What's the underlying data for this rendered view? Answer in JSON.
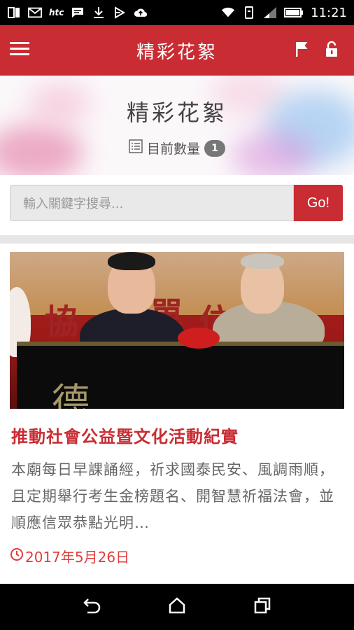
{
  "status_bar": {
    "carrier": "htc",
    "time": "11:21",
    "left_icons": [
      "sim-icon",
      "gmail-icon",
      "htc-icon",
      "message-icon",
      "download-icon",
      "nfc-icon",
      "cloud-upload-icon"
    ],
    "right_icons": [
      "wifi-icon",
      "vibrate-icon",
      "signal-icon",
      "battery-icon"
    ]
  },
  "app_bar": {
    "title": "精彩花絮",
    "menu_icon": "hamburger-menu-icon",
    "actions": [
      "flag-icon",
      "lock-icon"
    ]
  },
  "hero": {
    "title": "精彩花絮",
    "count_label": "目前數量",
    "count_value": "1"
  },
  "search": {
    "placeholder": "輸入關鍵字搜尋...",
    "button_label": "Go!"
  },
  "articles": [
    {
      "title": "推動社會公益暨文化活動紀實",
      "description": "本廟每日早課誦經，祈求國泰民安、風調雨順，且定期舉行考生金榜題名、開智慧祈福法會，並順應信眾恭點光明…",
      "date": "2017年5月26日"
    }
  ],
  "nav_bar": {
    "buttons": [
      "back-icon",
      "home-icon",
      "recent-apps-icon"
    ]
  },
  "colors": {
    "primary": "#c92c32",
    "date": "#e23c3c"
  }
}
